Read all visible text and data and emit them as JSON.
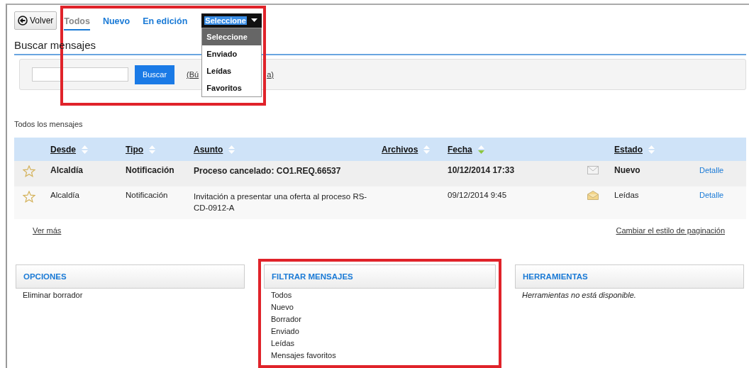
{
  "back_button": {
    "label": "Volver"
  },
  "tabs": [
    {
      "label": "Todos",
      "selected": true
    },
    {
      "label": "Nuevo",
      "selected": false
    },
    {
      "label": "En edición",
      "selected": false
    }
  ],
  "status_select": {
    "value": "Seleccione",
    "expanded": true,
    "highlighted": true,
    "options": [
      {
        "label": "Seleccione",
        "selected": true
      },
      {
        "label": "Enviado",
        "selected": false
      },
      {
        "label": "Leídas",
        "selected": false
      },
      {
        "label": "Favoritos",
        "selected": false
      }
    ]
  },
  "search": {
    "title": "Buscar mensajes",
    "button": "Buscar",
    "link_start": "(Bú",
    "link_end": "a)"
  },
  "list_title": "Todos los mensajes",
  "table": {
    "columns": [
      {
        "label": "Desde",
        "sorted": false
      },
      {
        "label": "Tipo",
        "sorted": false
      },
      {
        "label": "Asunto",
        "sorted": false
      },
      {
        "label": "Archivos",
        "sorted": false
      },
      {
        "label": "Fecha",
        "sorted": true
      },
      {
        "label": "Estado",
        "sorted": false
      }
    ],
    "rows": [
      {
        "favorite": false,
        "unread": true,
        "from": "Alcaldía",
        "type": "Notificación",
        "subject": "Proceso cancelado: CO1.REQ.66537",
        "date": "10/12/2014 17:33",
        "status": "Nuevo",
        "action": "Detalle"
      },
      {
        "favorite": false,
        "unread": false,
        "from": "Alcaldía",
        "type": "Notificación",
        "subject": "Invitación a presentar una oferta al proceso RS-CD-0912-A",
        "date": "09/12/2014 9:45",
        "status": "Leídas",
        "action": "Detalle"
      }
    ]
  },
  "more_link": "Ver más",
  "pagination_link": "Cambiar el estilo de paginación",
  "panels": [
    {
      "title": "OPCIONES",
      "kind": "plain",
      "highlighted": false,
      "items": [
        "Eliminar borrador"
      ]
    },
    {
      "title": "FILTRAR MENSAJES",
      "kind": "list",
      "highlighted": true,
      "items": [
        "Todos",
        "Nuevo",
        "Borrador",
        "Enviado",
        "Leídas",
        "Mensajes favoritos"
      ]
    },
    {
      "title": "HERRAMIENTAS",
      "kind": "note",
      "highlighted": false,
      "items": [
        "Herramientas no está disponible."
      ]
    }
  ]
}
